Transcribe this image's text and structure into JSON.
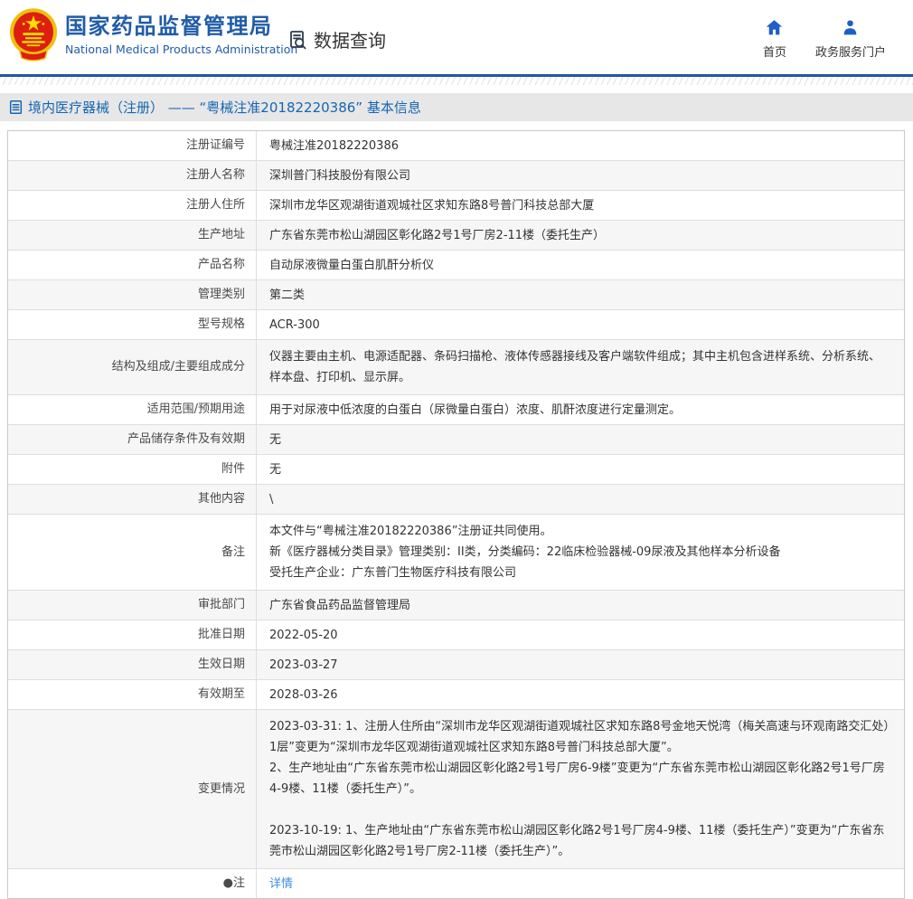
{
  "header": {
    "logo": "national-emblem",
    "org_name_cn": "国家药品监督管理局",
    "org_name_en": "National Medical Products Administration",
    "data_query_label": "数据查询",
    "nav": [
      {
        "label": "首页",
        "icon": "home-icon"
      },
      {
        "label": "政务服务门户",
        "icon": "person-icon"
      }
    ]
  },
  "title_bar": {
    "icon": "document-list-icon",
    "text": "境内医疗器械（注册） —— “粤械注准20182220386” 基本信息"
  },
  "table": {
    "rows": [
      {
        "label": "注册证编号",
        "value": "粤械注准20182220386"
      },
      {
        "label": "注册人名称",
        "value": "深圳普门科技股份有限公司"
      },
      {
        "label": "注册人住所",
        "value": "深圳市龙华区观湖街道观城社区求知东路8号普门科技总部大厦"
      },
      {
        "label": "生产地址",
        "value": "广东省东莞市松山湖园区彰化路2号1号厂房2-11楼（委托生产）"
      },
      {
        "label": "产品名称",
        "value": "自动尿液微量白蛋白肌酐分析仪"
      },
      {
        "label": "管理类别",
        "value": "第二类"
      },
      {
        "label": "型号规格",
        "value": "ACR-300"
      },
      {
        "label": "结构及组成/主要组成成分",
        "value": "仪器主要由主机、电源适配器、条码扫描枪、液体传感器接线及客户端软件组成；其中主机包含进样系统、分析系统、样本盘、打印机、显示屏。"
      },
      {
        "label": "适用范围/预期用途",
        "value": "用于对尿液中低浓度的白蛋白（尿微量白蛋白）浓度、肌酐浓度进行定量测定。"
      },
      {
        "label": "产品储存条件及有效期",
        "value": "无"
      },
      {
        "label": "附件",
        "value": "无"
      },
      {
        "label": "其他内容",
        "value": "\\"
      },
      {
        "label": "备注",
        "lines": [
          "本文件与“粤械注准20182220386”注册证共同使用。",
          "新《医疗器械分类目录》管理类别：II类，分类编码：22临床检验器械-09尿液及其他样本分析设备",
          "受托生产企业：广东普门生物医疗科技有限公司"
        ]
      },
      {
        "label": "审批部门",
        "value": "广东省食品药品监督管理局"
      },
      {
        "label": "批准日期",
        "value": "2022-05-20"
      },
      {
        "label": "生效日期",
        "value": "2023-03-27"
      },
      {
        "label": "有效期至",
        "value": "2028-03-26"
      },
      {
        "label": "变更情况",
        "paragraphs": [
          "2023-03-31: 1、注册人住所由“深圳市龙华区观湖街道观城社区求知东路8号金地天悦湾（梅关高速与环观南路交汇处）1层”变更为“深圳市龙华区观湖街道观城社区求知东路8号普门科技总部大厦”。",
          "2、生产地址由“广东省东莞市松山湖园区彰化路2号1号厂房6-9楼”变更为“广东省东莞市松山湖园区彰化路2号1号厂房4-9楼、11楼（委托生产）”。",
          "2023-10-19: 1、生产地址由“广东省东莞市松山湖园区彰化路2号1号厂房4-9楼、11楼（委托生产）”变更为“广东省东莞市松山湖园区彰化路2号1号厂房2-11楼（委托生产）”。"
        ]
      },
      {
        "label": "●注",
        "link_label": "详情"
      }
    ]
  },
  "colors": {
    "brand_blue": "#1f5ca9",
    "icon_blue": "#1d5fc6",
    "title_text_blue": "#1566b2",
    "link_blue": "#3f8fe0",
    "emblem_red": "#dd1e10",
    "emblem_gold": "#eec10c",
    "row_stripe": "#f6f6f6"
  }
}
